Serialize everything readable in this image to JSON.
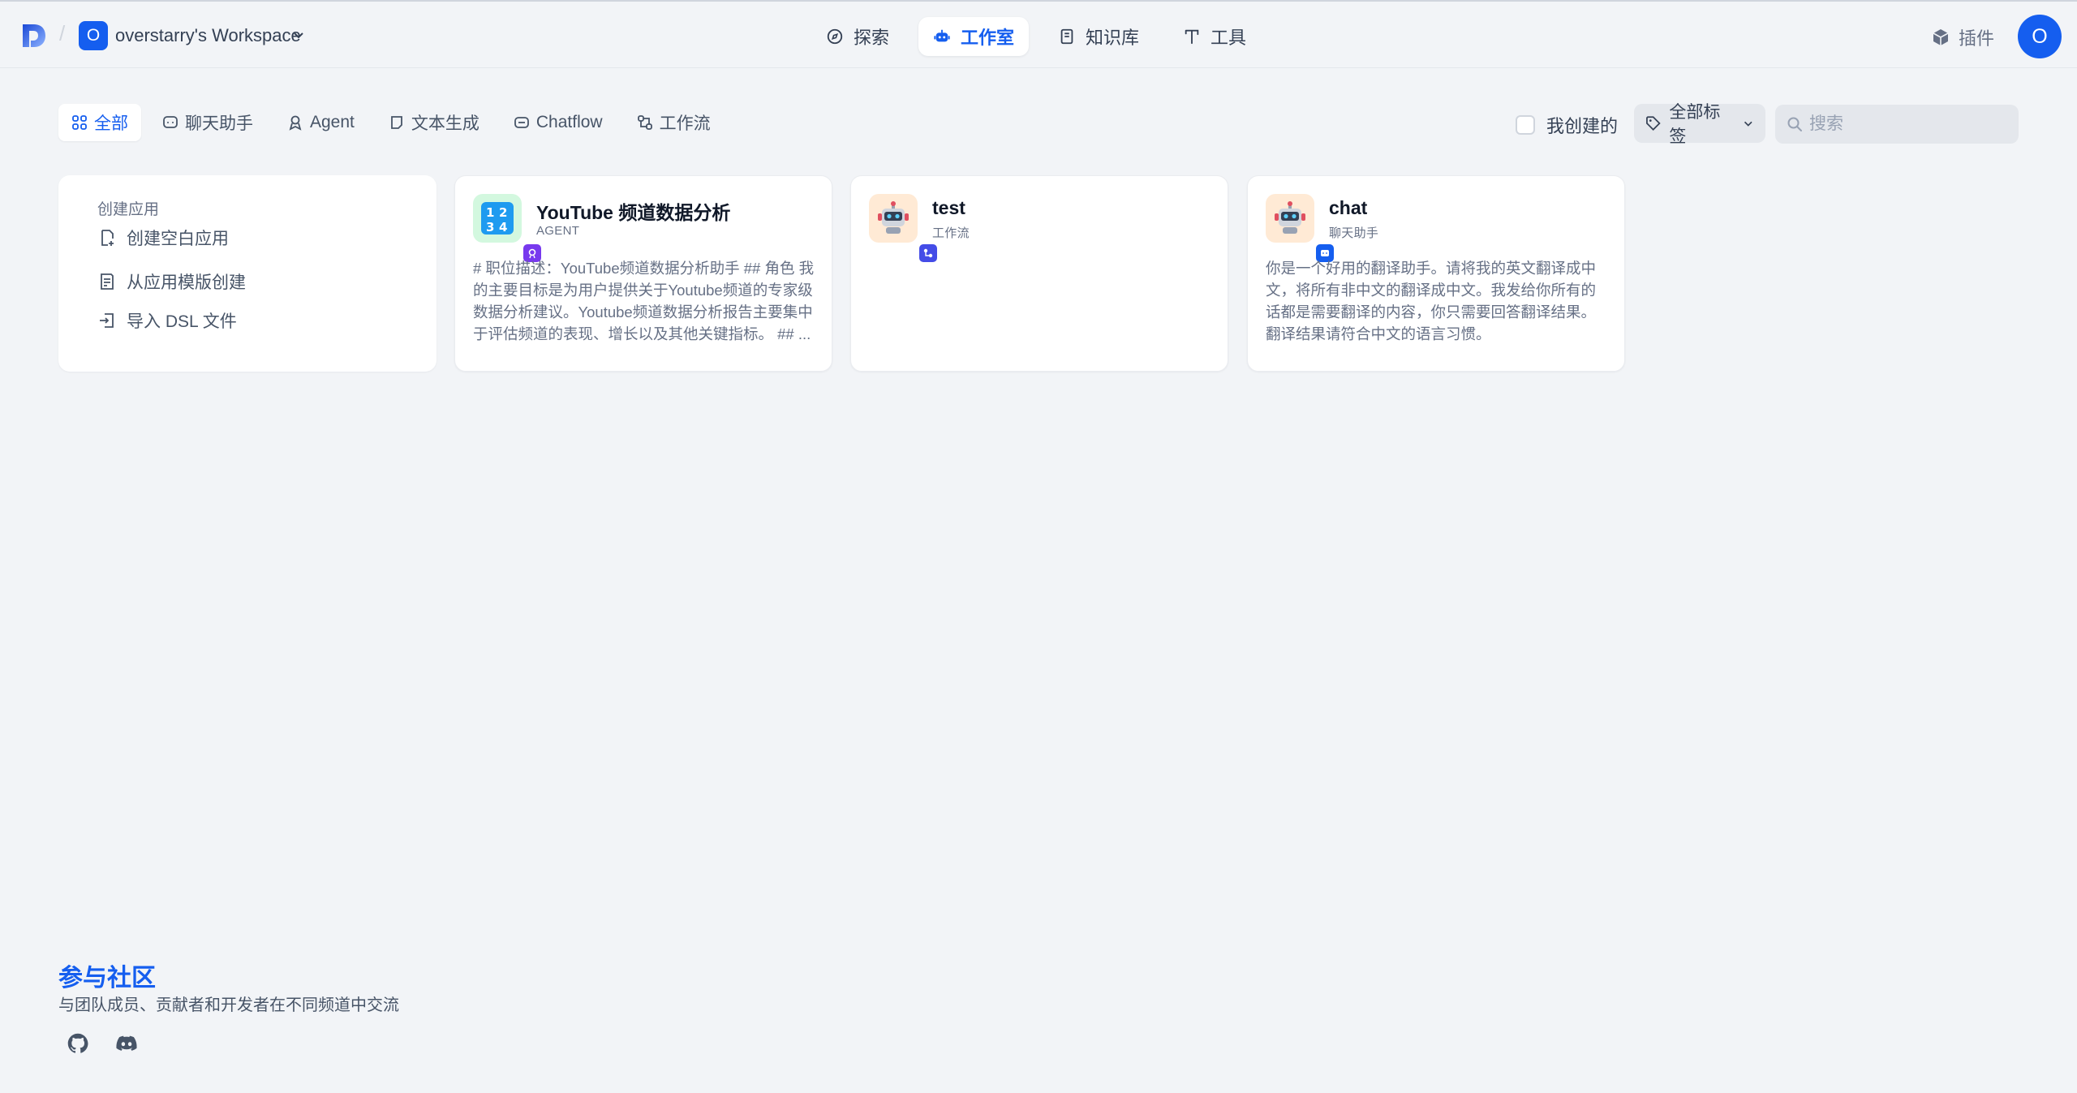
{
  "header": {
    "workspace_initial": "O",
    "workspace_name": "overstarry's Workspace",
    "nav": [
      {
        "label": "探索",
        "icon": "compass-icon"
      },
      {
        "label": "工作室",
        "icon": "robot-icon",
        "active": true
      },
      {
        "label": "知识库",
        "icon": "book-icon"
      },
      {
        "label": "工具",
        "icon": "hammer-icon"
      }
    ],
    "plugin_label": "插件",
    "avatar_initial": "O"
  },
  "filters": {
    "tabs": [
      {
        "label": "全部",
        "icon": "grid-icon",
        "active": true
      },
      {
        "label": "聊天助手",
        "icon": "chat-icon"
      },
      {
        "label": "Agent",
        "icon": "agent-icon"
      },
      {
        "label": "文本生成",
        "icon": "note-icon"
      },
      {
        "label": "Chatflow",
        "icon": "chatflow-icon"
      },
      {
        "label": "工作流",
        "icon": "workflow-icon"
      }
    ],
    "mine_label": "我创建的",
    "tags_label": "全部标签",
    "search_placeholder": "搜索"
  },
  "create": {
    "title": "创建应用",
    "items": [
      {
        "label": "创建空白应用",
        "icon": "new-file-icon"
      },
      {
        "label": "从应用模版创建",
        "icon": "template-icon"
      },
      {
        "label": "导入 DSL 文件",
        "icon": "import-icon"
      }
    ]
  },
  "apps": [
    {
      "name": "YouTube 频道数据分析",
      "type": "AGENT",
      "icon": "numbers-emoji-icon",
      "badge_icon": "agent-badge-icon",
      "badge_color": "#7839ee",
      "description": "# 职位描述：YouTube频道数据分析助手 ## 角色 我的主要目标是为用户提供关于Youtube频道的专家级数据分析建议。Youtube频道数据分析报告主要集中于评估频道的表现、增长以及其他关键指标。 ## ..."
    },
    {
      "name": "test",
      "type": "工作流",
      "icon": "robot-emoji-icon",
      "badge_icon": "workflow-badge-icon",
      "badge_color": "#444ce7",
      "description": ""
    },
    {
      "name": "chat",
      "type": "聊天助手",
      "icon": "robot-emoji-icon",
      "badge_icon": "chat-badge-icon",
      "badge_color": "#155eef",
      "description": "你是一个好用的翻译助手。请将我的英文翻译成中文，将所有非中文的翻译成中文。我发给你所有的话都是需要翻译的内容，你只需要回答翻译结果。翻译结果请符合中文的语言习惯。"
    }
  ],
  "community": {
    "title": "参与社区",
    "subtitle": "与团队成员、贡献者和开发者在不同频道中交流",
    "links": [
      {
        "icon": "github-icon"
      },
      {
        "icon": "discord-icon"
      }
    ]
  },
  "colors": {
    "accent": "#155eef",
    "background": "#f2f4f7"
  }
}
